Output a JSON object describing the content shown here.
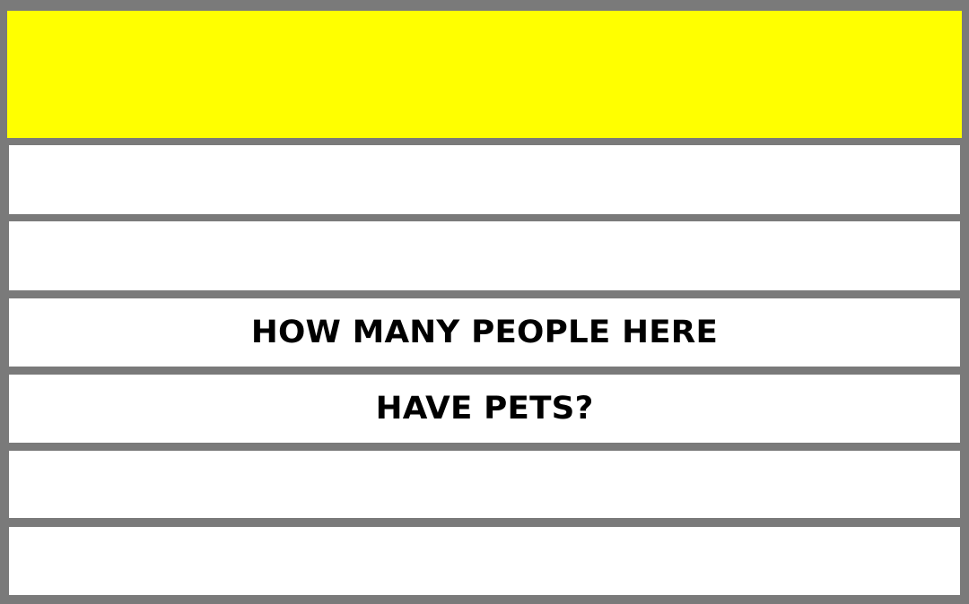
{
  "card": {
    "header_color": "#ffff00",
    "border_color": "#7a7a7a",
    "lines": [
      "",
      "",
      "HOW MANY PEOPLE HERE",
      "HAVE PETS?",
      "",
      ""
    ]
  }
}
